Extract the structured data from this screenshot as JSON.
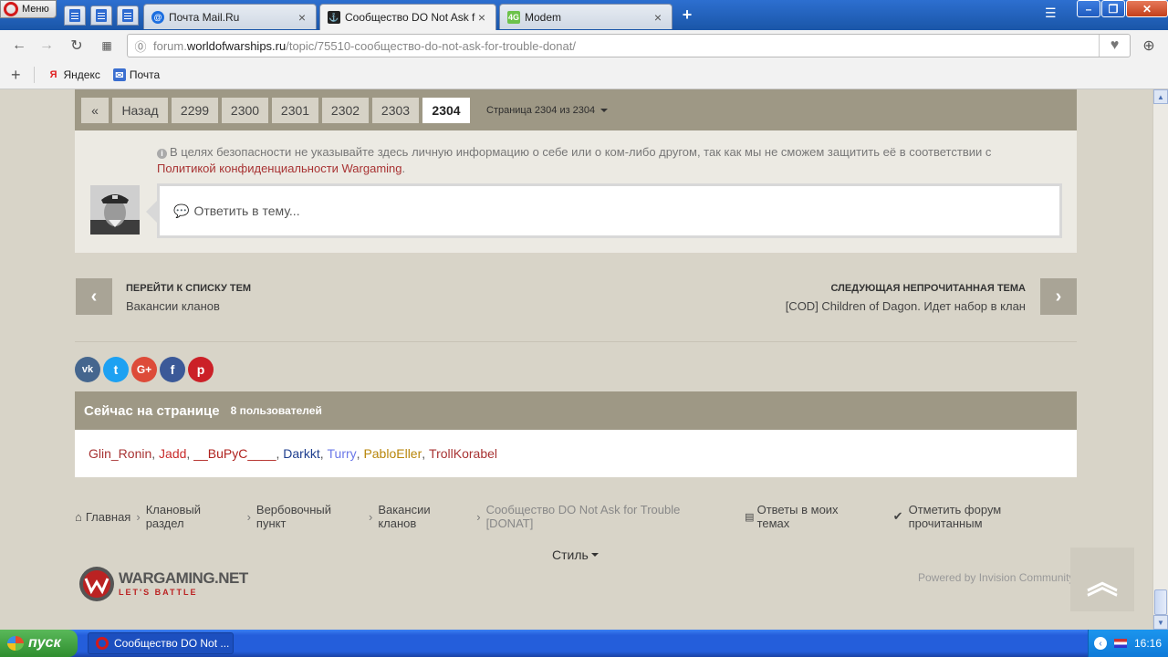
{
  "browser": {
    "menu_label": "Меню",
    "tabs": [
      {
        "title": "Почта Mail.Ru",
        "icon": "mailru-icon"
      },
      {
        "title": "Сообщество DO Not Ask for",
        "icon": "wows-icon"
      },
      {
        "title": "Modem",
        "icon": "4g-icon",
        "icon_text": "4G"
      }
    ],
    "new_tab": "+",
    "url_host_prefix": "forum.",
    "url_host": "worldofwarships.ru",
    "url_path": "/topic/75510-сообщество-do-not-ask-for-trouble-donat/",
    "bookmarks": [
      {
        "label": "Яндекс",
        "icon": "yandex-icon",
        "icon_text": "Я"
      },
      {
        "label": "Почта",
        "icon": "mail-icon"
      }
    ]
  },
  "pagination": {
    "first": "«",
    "back": "Назад",
    "pages": [
      "2299",
      "2300",
      "2301",
      "2302",
      "2303",
      "2304"
    ],
    "current": "2304",
    "info": "Страница 2304 из 2304"
  },
  "reply": {
    "notice": "В целях безопасности не указывайте здесь личную информацию о себе или о ком-либо другом, так как мы не сможем защитить её в соответствии с",
    "policy_link": "Политикой конфиденциальности Wargaming",
    "placeholder": "Ответить в тему..."
  },
  "topic_nav": {
    "prev_title": "ПЕРЕЙТИ К СПИСКУ ТЕМ",
    "prev_sub": "Вакансии кланов",
    "next_title": "СЛЕДУЮЩАЯ НЕПРОЧИТАННАЯ ТЕМА",
    "next_sub": "[COD] Children of Dagon. Идет набор в клан"
  },
  "social": [
    {
      "name": "vk-icon",
      "glyph": "vk",
      "color": "#45668e"
    },
    {
      "name": "twitter-icon",
      "glyph": "t",
      "color": "#1da1f2"
    },
    {
      "name": "google-plus-icon",
      "glyph": "G+",
      "color": "#dd4b39"
    },
    {
      "name": "facebook-icon",
      "glyph": "f",
      "color": "#3b5998"
    },
    {
      "name": "pinterest-icon",
      "glyph": "p",
      "color": "#cb2027"
    }
  ],
  "online": {
    "title": "Сейчас на странице",
    "count": "8 пользователей",
    "users": [
      {
        "name": "Glin_Ronin",
        "color": "#a83333"
      },
      {
        "name": "Jadd",
        "color": "#c92d2d"
      },
      {
        "name": "__BuPyC____",
        "color": "#b0231f"
      },
      {
        "name": "Darkkt",
        "color": "#1f3f8f"
      },
      {
        "name": "Turry",
        "color": "#6b78e8"
      },
      {
        "name": "PabloEller",
        "color": "#b8860b"
      },
      {
        "name": "TrollKorabel",
        "color": "#a83333"
      }
    ]
  },
  "breadcrumbs": {
    "home": "Главная",
    "items": [
      "Клановый раздел",
      "Вербовочный пункт",
      "Вакансии кланов"
    ],
    "current": "Сообщество DO Not Ask for Trouble [DONAT]",
    "replies": "Ответы в моих темах",
    "mark_read": "Отметить форум прочитанным"
  },
  "footer": {
    "style": "Стиль",
    "logo_main": "WARGAMING.NET",
    "logo_sub": "LET'S BATTLE",
    "powered": "Powered by Invision Community"
  },
  "taskbar": {
    "start": "пуск",
    "task": "Сообщество DO Not ...",
    "clock": "16:16"
  }
}
